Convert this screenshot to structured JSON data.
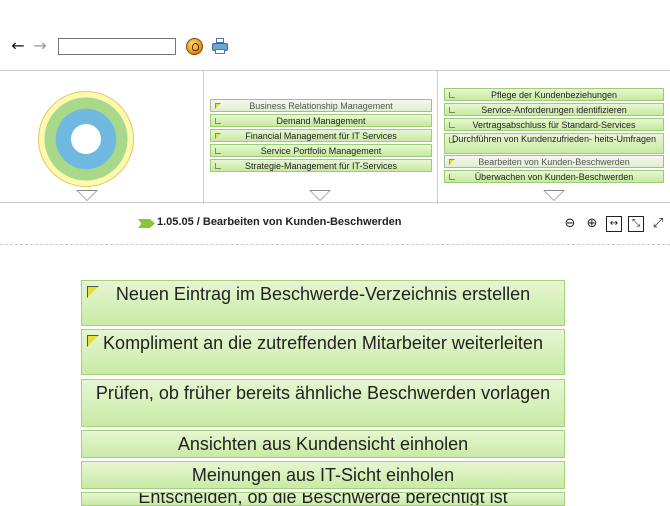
{
  "toolbar": {
    "search_value": ""
  },
  "column2": {
    "items": [
      {
        "label": "Business Relationship Management",
        "selected": true
      },
      {
        "label": "Demand Management",
        "selected": false
      },
      {
        "label": "Financial Management für IT Services",
        "selected": false
      },
      {
        "label": "Service Portfolio Management",
        "selected": false
      },
      {
        "label": "Strategie-Management für IT-Services",
        "selected": false
      }
    ]
  },
  "column3": {
    "items": [
      {
        "label": "Pflege der Kundenbeziehungen"
      },
      {
        "label": "Service-Anforderungen identifizieren"
      },
      {
        "label": "Vertragsabschluss für Standard-Services"
      },
      {
        "label": "Durchführen von Kundenzufrieden- heits-Umfragen"
      },
      {
        "label": "Bearbeiten von Kunden-Beschwerden"
      },
      {
        "label": "Überwachen von Kunden-Beschwerden"
      }
    ]
  },
  "breadcrumb": {
    "text": "1.05.05 / Bearbeiten von Kunden-Beschwerden"
  },
  "steps": [
    {
      "label": "Neuen Eintrag im Beschwerde-Verzeichnis erstellen"
    },
    {
      "label": "Kompliment an die zutreffenden Mitarbeiter weiterleiten"
    },
    {
      "label": "Prüfen, ob früher bereits ähnliche Beschwerden vorlagen"
    },
    {
      "label": "Ansichten aus Kundensicht einholen"
    },
    {
      "label": "Meinungen aus IT-Sicht einholen"
    },
    {
      "label": "Entscheiden, ob die Beschwerde berechtigt ist"
    }
  ],
  "colors": {
    "accent_green": "#8ac43a",
    "box_green": "#c9eaa5"
  }
}
